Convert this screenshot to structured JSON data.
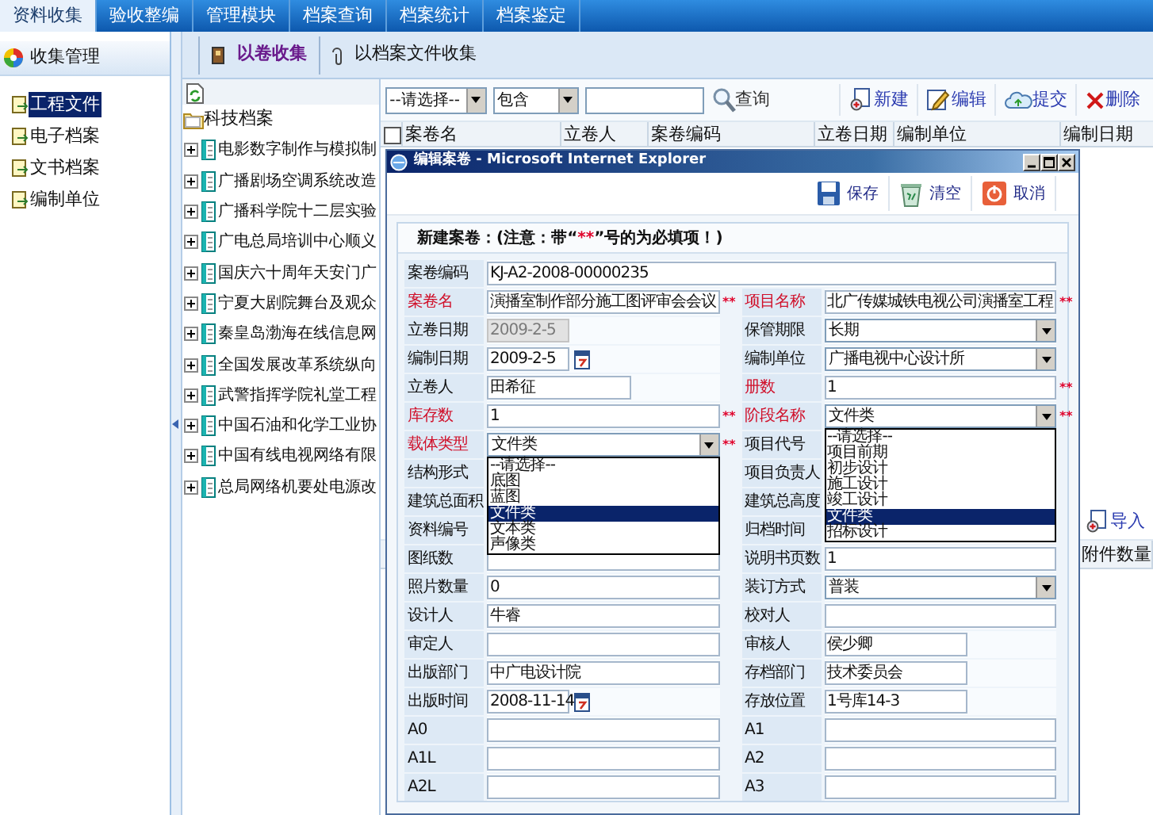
{
  "menu": [
    {
      "label": "资料收集",
      "selected": true
    },
    {
      "label": "验收整编",
      "selected": false
    },
    {
      "label": "管理模块",
      "selected": false
    },
    {
      "label": "档案查询",
      "selected": false
    },
    {
      "label": "档案统计",
      "selected": false
    },
    {
      "label": "档案鉴定",
      "selected": false
    }
  ],
  "sidebar": {
    "title": "收集管理",
    "items": [
      {
        "label": "工程文件",
        "selected": true
      },
      {
        "label": "电子档案",
        "selected": false
      },
      {
        "label": "文书档案",
        "selected": false
      },
      {
        "label": "编制单位",
        "selected": false
      }
    ]
  },
  "collect_tabs": [
    {
      "label": "以卷收集",
      "selected": true
    },
    {
      "label": "以档案文件收集",
      "selected": false
    }
  ],
  "tree": {
    "root": "科技档案",
    "children": [
      {
        "label": "电影数字制作与模拟制",
        "expanded": false
      },
      {
        "label": "广播剧场空调系统改造",
        "expanded": false
      },
      {
        "label": "广播科学院十二层实验",
        "expanded": false
      },
      {
        "label": "广电总局培训中心顺义",
        "expanded": false
      },
      {
        "label": "国庆六十周年天安门广",
        "expanded": false
      },
      {
        "label": "宁夏大剧院舞台及观众",
        "expanded": false
      },
      {
        "label": "秦皇岛渤海在线信息网",
        "expanded": false
      },
      {
        "label": "全国发展改革系统纵向",
        "expanded": false
      },
      {
        "label": "武警指挥学院礼堂工程",
        "expanded": false
      },
      {
        "label": "中国石油和化学工业协",
        "expanded": false
      },
      {
        "label": "中国有线电视网络有限",
        "expanded": false
      },
      {
        "label": "总局网络机要处电源改",
        "expanded": false
      }
    ]
  },
  "search": {
    "field": "--请选择--",
    "operator": "包含",
    "button": "查询"
  },
  "toolbar": [
    {
      "kind": "new",
      "label": "新建"
    },
    {
      "kind": "edit",
      "label": "编辑"
    },
    {
      "kind": "submit",
      "label": "提交"
    },
    {
      "kind": "delete",
      "label": "删除"
    }
  ],
  "table": {
    "select_all": false,
    "columns": [
      "案卷名",
      "立卷人",
      "案卷编码",
      "立卷日期",
      "编制单位",
      "编制日期"
    ]
  },
  "lower_pane": {
    "button": "导入",
    "columns": [
      "附件数量"
    ]
  },
  "dialog": {
    "title": "编辑案卷 - Microsoft Internet Explorer",
    "toolbar": [
      {
        "kind": "save",
        "label": "保存"
      },
      {
        "kind": "clear",
        "label": "清空"
      },
      {
        "kind": "cancel",
        "label": "取消"
      }
    ],
    "note": {
      "before": "新建案卷：(注意：带“",
      "mark": "**",
      "after": "”号的为必填项！)"
    },
    "fields": [
      {
        "label": "案卷编码",
        "kind": "wide",
        "required": false,
        "disabled": false,
        "value": "KJ-A2-2008-00000235"
      },
      {
        "label": "案卷名",
        "kind": "text",
        "required": true,
        "disabled": false,
        "value": "演播室制作部分施工图评审会会议"
      },
      {
        "label": "项目名称",
        "kind": "text",
        "required": true,
        "disabled": false,
        "value": "北广传媒城铁电视公司演播室工程"
      },
      {
        "label": "立卷日期",
        "kind": "date",
        "required": false,
        "disabled": true,
        "value": "2009-2-5"
      },
      {
        "label": "保管期限",
        "kind": "select",
        "required": false,
        "disabled": false,
        "value": "长期"
      },
      {
        "label": "编制日期",
        "kind": "date",
        "required": false,
        "disabled": false,
        "value": "2009-2-5"
      },
      {
        "label": "编制单位",
        "kind": "select",
        "required": false,
        "disabled": false,
        "value": "广播电视中心设计所"
      },
      {
        "label": "立卷人",
        "kind": "short",
        "required": false,
        "disabled": false,
        "value": "田希征"
      },
      {
        "label": "册数",
        "kind": "text",
        "required": true,
        "disabled": false,
        "value": "1"
      },
      {
        "label": "库存数",
        "kind": "text",
        "required": true,
        "disabled": false,
        "value": "1"
      },
      {
        "label": "阶段名称",
        "kind": "select",
        "required": true,
        "disabled": false,
        "value": "文件类",
        "options": [
          {
            "label": "--请选择--",
            "selected": false
          },
          {
            "label": "项目前期",
            "selected": false
          },
          {
            "label": "初步设计",
            "selected": false
          },
          {
            "label": "施工设计",
            "selected": false
          },
          {
            "label": "竣工设计",
            "selected": false
          },
          {
            "label": "文件类",
            "selected": true
          },
          {
            "label": "招标设计",
            "selected": false
          }
        ]
      },
      {
        "label": "载体类型",
        "kind": "select",
        "required": true,
        "disabled": false,
        "value": "文件类",
        "options": [
          {
            "label": "--请选择--",
            "selected": false
          },
          {
            "label": "底图",
            "selected": false
          },
          {
            "label": "蓝图",
            "selected": false
          },
          {
            "label": "文件类",
            "selected": true
          },
          {
            "label": "文本类",
            "selected": false
          },
          {
            "label": "声像类",
            "selected": false
          }
        ]
      },
      {
        "label": "项目代号",
        "kind": "text",
        "required": false
      },
      {
        "label": "结构形式",
        "kind": "text",
        "required": false
      },
      {
        "label": "项目负责人",
        "kind": "text",
        "required": false
      },
      {
        "label": "建筑总面积",
        "kind": "text",
        "required": false
      },
      {
        "label": "建筑总高度",
        "kind": "text",
        "required": false
      },
      {
        "label": "资料编号",
        "kind": "text",
        "required": false
      },
      {
        "label": "归档时间",
        "kind": "text",
        "required": false
      },
      {
        "label": "图纸数",
        "kind": "text",
        "required": false,
        "disabled": false
      },
      {
        "label": "说明书页数",
        "kind": "text",
        "required": false,
        "disabled": false,
        "value": "1"
      },
      {
        "label": "照片数量",
        "kind": "text",
        "required": false,
        "disabled": false,
        "value": "0"
      },
      {
        "label": "装订方式",
        "kind": "select",
        "required": false,
        "disabled": false,
        "value": "普装"
      },
      {
        "label": "设计人",
        "kind": "text",
        "required": false,
        "disabled": false,
        "value": "牛睿"
      },
      {
        "label": "校对人",
        "kind": "text",
        "required": false,
        "disabled": false
      },
      {
        "label": "审定人",
        "kind": "text",
        "required": false,
        "disabled": false
      },
      {
        "label": "审核人",
        "kind": "short",
        "required": false,
        "disabled": false,
        "value": "侯少卿"
      },
      {
        "label": "出版部门",
        "kind": "text",
        "required": false,
        "disabled": false,
        "value": "中广电设计院"
      },
      {
        "label": "存档部门",
        "kind": "short",
        "required": false,
        "disabled": false,
        "value": "技术委员会"
      },
      {
        "label": "出版时间",
        "kind": "date",
        "required": false,
        "disabled": false,
        "value": "2008-11-14"
      },
      {
        "label": "存放位置",
        "kind": "short",
        "required": false,
        "disabled": false,
        "value": "1号库14-3"
      },
      {
        "label": "A0",
        "kind": "text",
        "required": false,
        "disabled": false
      },
      {
        "label": "A1",
        "kind": "text",
        "required": false,
        "disabled": false
      },
      {
        "label": "A1L",
        "kind": "text",
        "required": false,
        "disabled": false
      },
      {
        "label": "A2",
        "kind": "text",
        "required": false,
        "disabled": false
      },
      {
        "label": "A2L",
        "kind": "text",
        "required": false,
        "disabled": false
      },
      {
        "label": "A3",
        "kind": "text",
        "required": false,
        "disabled": false
      }
    ]
  }
}
